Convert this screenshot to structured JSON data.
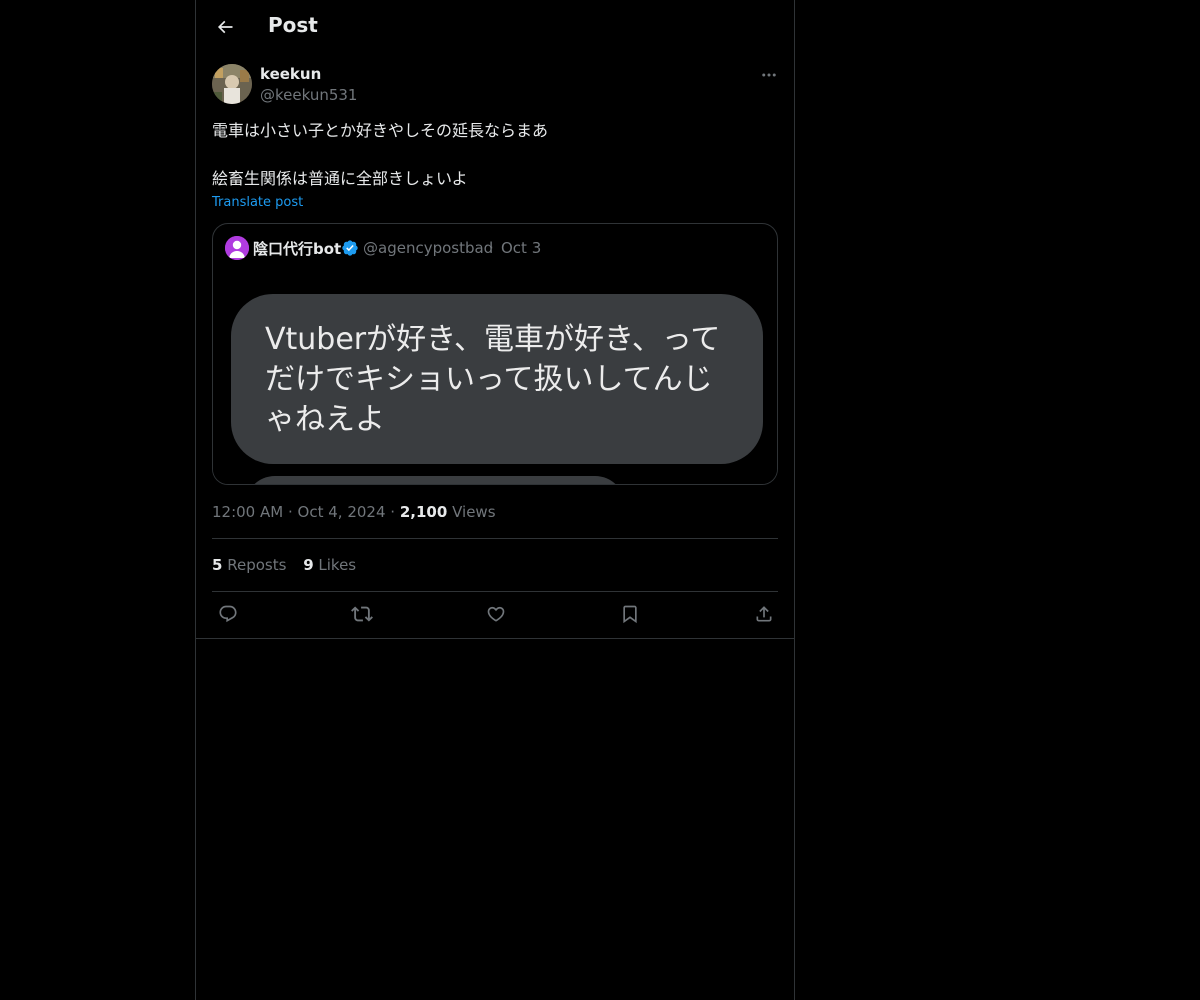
{
  "header": {
    "title": "Post",
    "back_icon": "arrow-left-icon"
  },
  "post": {
    "author_name": "keekun",
    "author_handle": "@keekun531",
    "text_line1": "電車は小さい子とか好きやしその延長ならまあ",
    "text_line2": "絵畜生関係は普通に全部きしょいよ",
    "translate_label": "Translate post",
    "time": "12:00 AM",
    "date": "Oct 4, 2024",
    "views_count": "2,100",
    "views_label": "Views",
    "dot": "·"
  },
  "quote": {
    "name": "陰口代行bot",
    "handle": "@agencypostbad",
    "dot": "·",
    "date": "Oct 3",
    "image_text": "Vtuberが好き、電車が好き、ってだけでキショいって扱いしてんじゃねえよ"
  },
  "stats": {
    "reposts_count": "5",
    "reposts_label": "Reposts",
    "likes_count": "9",
    "likes_label": "Likes"
  },
  "colors": {
    "background": "#000000",
    "text": "#e7e9ea",
    "secondary": "#71767b",
    "link": "#1d9bf0",
    "border": "#2f3336",
    "verified": "#1d9bf0"
  }
}
